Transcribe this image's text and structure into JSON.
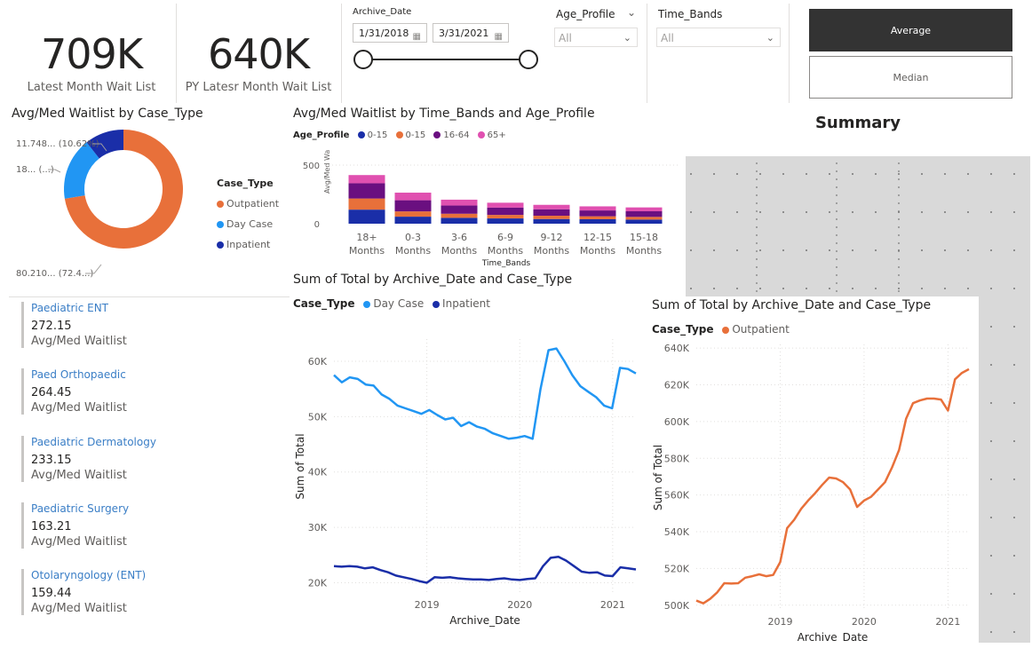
{
  "kpi": [
    {
      "value": "709K",
      "label": "Latest Month Wait List"
    },
    {
      "value": "640K",
      "label": "PY Latesr Month Wait List"
    }
  ],
  "archive_slicer": {
    "title": "Archive_Date",
    "start": "1/31/2018",
    "end": "3/31/2021"
  },
  "age_slicer": {
    "title": "Age_Profile",
    "value": "All"
  },
  "time_slicer": {
    "title": "Time_Bands",
    "value": "All"
  },
  "buttons": {
    "average": "Average",
    "median": "Median"
  },
  "summary_title": "Summary",
  "colors": {
    "outpatient": "#e8703a",
    "daycase": "#2196f3",
    "inpatient": "#1a2ea8",
    "purple": "#6a0f80",
    "pink": "#e050b0",
    "active_btn": "#333333"
  },
  "donut": {
    "title": "Avg/Med Waitlist by Case_Type",
    "legend_title": "Case_Type",
    "labels": [
      "11.748... (10.62%)",
      "18... (...)",
      "80.210... (72.4...)"
    ],
    "chart_data": {
      "type": "pie",
      "categories": [
        "Outpatient",
        "Day Case",
        "Inpatient"
      ],
      "values": [
        72.4,
        16.98,
        10.62
      ]
    }
  },
  "bar": {
    "title": "Avg/Med Waitlist by Time_Bands and Age_Profile",
    "legend_title": "Age_Profile",
    "legend": [
      "0-15",
      "0-15",
      "16-64",
      "65+"
    ],
    "ylabel": "Avg/Med Waitlist",
    "xlabel": "Time_Bands",
    "yticks": [
      "500",
      "0"
    ],
    "chart_data": {
      "type": "bar",
      "stacked": true,
      "categories": [
        [
          "18+",
          "Months"
        ],
        [
          "0-3",
          "Months"
        ],
        [
          "3-6",
          "Months"
        ],
        [
          "6-9",
          "Months"
        ],
        [
          "9-12",
          "Months"
        ],
        [
          "12-15",
          "Months"
        ],
        [
          "15-18",
          "Months"
        ]
      ],
      "ylim": [
        0,
        500
      ],
      "series": [
        {
          "name": "0-15",
          "color": "#1a2ea8",
          "values": [
            120,
            60,
            50,
            45,
            40,
            38,
            35
          ]
        },
        {
          "name": "0-15",
          "color": "#e8703a",
          "values": [
            95,
            45,
            35,
            30,
            28,
            25,
            23
          ]
        },
        {
          "name": "16-64",
          "color": "#6a0f80",
          "values": [
            130,
            95,
            70,
            62,
            55,
            50,
            48
          ]
        },
        {
          "name": "65+",
          "color": "#e050b0",
          "values": [
            70,
            65,
            50,
            42,
            38,
            35,
            33
          ]
        }
      ]
    }
  },
  "multirow": [
    {
      "title": "Paediatric ENT",
      "value": "272.15",
      "sub": "Avg/Med Waitlist"
    },
    {
      "title": "Paed Orthopaedic",
      "value": "264.45",
      "sub": "Avg/Med Waitlist"
    },
    {
      "title": "Paediatric Dermatology",
      "value": "233.15",
      "sub": "Avg/Med Waitlist"
    },
    {
      "title": "Paediatric Surgery",
      "value": "163.21",
      "sub": "Avg/Med Waitlist"
    },
    {
      "title": "Otolaryngology (ENT)",
      "value": "159.44",
      "sub": "Avg/Med Waitlist"
    }
  ],
  "line1": {
    "title": "Sum of Total by Archive_Date and Case_Type",
    "legend_title": "Case_Type",
    "legend": [
      "Day Case",
      "Inpatient"
    ],
    "xlabel": "Archive_Date",
    "ylabel": "Sum of Total",
    "yticks": [
      "60K",
      "50K",
      "40K",
      "30K",
      "20K"
    ],
    "xticks": [
      "2019",
      "2020",
      "2021"
    ],
    "chart_data": {
      "type": "line",
      "x_start": 2018.0,
      "x_end": 2021.25,
      "ylim": [
        18000,
        64000
      ],
      "series": [
        {
          "name": "Day Case",
          "color": "#2196f3",
          "values": [
            57500,
            56200,
            57100,
            56800,
            55800,
            55600,
            54000,
            53200,
            52000,
            51500,
            51000,
            50500,
            51200,
            50300,
            49500,
            49800,
            48300,
            49000,
            48200,
            47800,
            47000,
            46500,
            46000,
            46200,
            46500,
            46000,
            55000,
            62000,
            62300,
            60000,
            57500,
            55500,
            54500,
            53500,
            52000,
            51500,
            58800,
            58600,
            57800
          ]
        },
        {
          "name": "Inpatient",
          "color": "#1a2ea8",
          "values": [
            23000,
            22900,
            23000,
            22900,
            22600,
            22800,
            22300,
            21900,
            21300,
            21000,
            20700,
            20300,
            20000,
            21000,
            20900,
            21000,
            20800,
            20700,
            20600,
            20600,
            20500,
            20700,
            20800,
            20600,
            20500,
            20700,
            20800,
            23000,
            24500,
            24700,
            24000,
            23000,
            22000,
            21800,
            21900,
            21300,
            21200,
            22800,
            22600,
            22400
          ]
        }
      ]
    }
  },
  "line2": {
    "title": "Sum of Total by Archive_Date and Case_Type",
    "legend_title": "Case_Type",
    "legend": [
      "Outpatient"
    ],
    "xlabel": "Archive_Date",
    "ylabel": "Sum of Total",
    "yticks": [
      "640K",
      "620K",
      "600K",
      "580K",
      "560K",
      "540K",
      "520K",
      "500K"
    ],
    "xticks": [
      "2019",
      "2020",
      "2021"
    ],
    "chart_data": {
      "type": "line",
      "x_start": 2018.0,
      "x_end": 2021.25,
      "ylim": [
        497000,
        642000
      ],
      "series": [
        {
          "name": "Outpatient",
          "color": "#e8703a",
          "values": [
            502500,
            501000,
            503500,
            507000,
            512000,
            511800,
            512000,
            515000,
            515800,
            516800,
            515800,
            516500,
            523500,
            542000,
            546500,
            552500,
            557000,
            561000,
            565500,
            569500,
            569000,
            567000,
            563000,
            553500,
            557000,
            559000,
            563000,
            567000,
            575000,
            584500,
            601500,
            610000,
            611500,
            612500,
            612500,
            612000,
            606000,
            623000,
            626500,
            628500
          ]
        }
      ]
    }
  }
}
